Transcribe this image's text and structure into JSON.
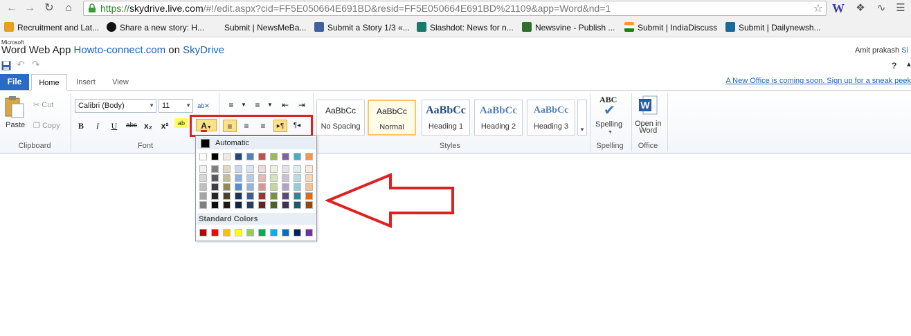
{
  "browser": {
    "url_https": "https://",
    "url_host": "skydrive.live.com",
    "url_path": "/#!/edit.aspx?cid=FF5E050664E691BD&resid=FF5E050664E691BD%21109&app=Word&nd=1",
    "ext_w": "W",
    "bookmarks": [
      {
        "label": "Recruitment and Lat...",
        "color": "#e8a020"
      },
      {
        "label": "Share a new story: H...",
        "color": "#111111"
      },
      {
        "label": "Submit | NewsMeBa...",
        "color": "#ffffff"
      },
      {
        "label": "Submit a Story 1/3 «...",
        "color": "#4060a0"
      },
      {
        "label": "Slashdot: News for n...",
        "color": "#1a7a6a"
      },
      {
        "label": "Newsvine - Publish ...",
        "color": "#2f6f2f"
      },
      {
        "label": "Submit | IndiaDiscuss",
        "color": "#e06020"
      },
      {
        "label": "Submit | Dailynewsh...",
        "color": "#1a6a9a"
      }
    ]
  },
  "app": {
    "brand_small": "Microsoft",
    "app_name": "Word Web App",
    "doc_link": "Howto-connect.com",
    "on_text": "on",
    "skydrive": "SkyDrive",
    "user": "Amit prakash",
    "user_tail": "Si",
    "help": "?"
  },
  "tabs": {
    "file": "File",
    "home": "Home",
    "insert": "Insert",
    "view": "View",
    "banner": "A New Office is coming soon. Sign up for a sneak peek"
  },
  "ribbon": {
    "clipboard": {
      "paste": "Paste",
      "cut": "Cut",
      "copy": "Copy",
      "label": "Clipboard"
    },
    "font": {
      "family": "Calibri (Body)",
      "size": "11",
      "label": "Font",
      "bold": "B",
      "italic": "I",
      "underline": "U",
      "strike": "abc",
      "sub": "x₂",
      "sup": "x²"
    },
    "paragraph": {
      "ltr": "▸¶",
      "rtl": "¶◂"
    },
    "styles": {
      "label": "Styles",
      "items": [
        {
          "sample": "AaBbCc",
          "name": "No Spacing"
        },
        {
          "sample": "AaBbCc",
          "name": "Normal"
        },
        {
          "sample": "AaBbCc",
          "name": "Heading 1"
        },
        {
          "sample": "AaBbCc",
          "name": "Heading 2"
        },
        {
          "sample": "AaBbCc",
          "name": "Heading 3"
        }
      ]
    },
    "spelling": {
      "label": "Spelling",
      "button": "Spelling",
      "abc": "ABC"
    },
    "office": {
      "label": "Office",
      "button_l1": "Open in",
      "button_l2": "Word"
    }
  },
  "color_menu": {
    "automatic": "Automatic",
    "standard_label": "Standard Colors",
    "theme_top": [
      "#ffffff",
      "#000000",
      "#eeece1",
      "#1f497d",
      "#4f81bd",
      "#c0504d",
      "#9bbb59",
      "#8064a2",
      "#4bacc6",
      "#f79646"
    ],
    "theme_shades": [
      [
        "#f2f2f2",
        "#7f7f7f",
        "#ddd9c3",
        "#c6d9f0",
        "#dbe5f1",
        "#f2dcdb",
        "#ebf1dd",
        "#e5e0ec",
        "#dbeef3",
        "#fdeada"
      ],
      [
        "#d8d8d8",
        "#595959",
        "#c4bd97",
        "#8db3e2",
        "#b8cce4",
        "#e5b9b7",
        "#d7e3bc",
        "#ccc1d9",
        "#b7dde8",
        "#fbd5b5"
      ],
      [
        "#bfbfbf",
        "#3f3f3f",
        "#938953",
        "#548dd4",
        "#95b3d7",
        "#d99694",
        "#c3d69b",
        "#b2a2c7",
        "#92cddc",
        "#fac08f"
      ],
      [
        "#a5a5a5",
        "#262626",
        "#494429",
        "#17365d",
        "#366092",
        "#953734",
        "#76923c",
        "#5f497a",
        "#31859b",
        "#e36c09"
      ],
      [
        "#7f7f7f",
        "#0c0c0c",
        "#1d1b10",
        "#0f243e",
        "#244061",
        "#632423",
        "#4f6128",
        "#3f3151",
        "#205867",
        "#974806"
      ]
    ],
    "standard": [
      "#c00000",
      "#ff0000",
      "#ffc000",
      "#ffff00",
      "#92d050",
      "#00b050",
      "#00b0f0",
      "#0070c0",
      "#002060",
      "#7030a0"
    ]
  },
  "colors": {
    "accent_red": "#e02020",
    "file_blue": "#2a6cc5",
    "link_blue": "#1a63b8"
  }
}
